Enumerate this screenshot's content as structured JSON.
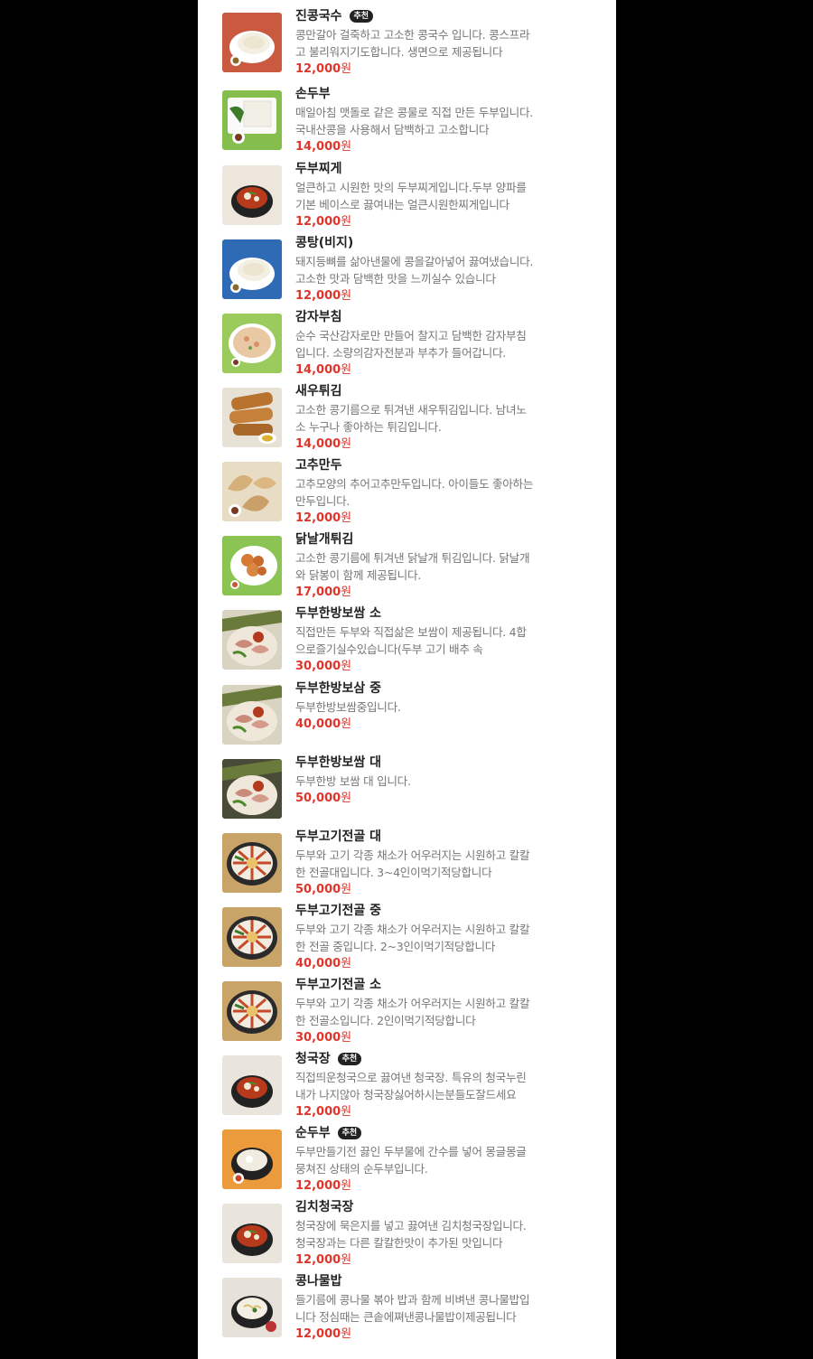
{
  "currency": "원",
  "badge_label": "추천",
  "items": [
    {
      "name": "진콩국수",
      "badge": true,
      "desc": [
        "콩만갈아 걸죽하고 고소한 콩국수 입니다. 콩스프라",
        "고 불리워지기도합니다. 생면으로 제공됩니다"
      ],
      "price": "12,000",
      "thumb": {
        "bg": "#c9593f",
        "dish": "bowl-white"
      }
    },
    {
      "name": "손두부",
      "badge": false,
      "desc": [
        "매일아침 맷돌로 같은 콩물로 직접 만든 두부입니다.",
        "국내산콩을 사용해서 담백하고 고소합니다"
      ],
      "price": "14,000",
      "thumb": {
        "bg": "#86be4e",
        "dish": "tofu"
      }
    },
    {
      "name": "두부찌게",
      "badge": false,
      "desc": [
        "얼큰하고 시원한 맛의 두부찌게입니다.두부 양파를",
        "기본 베이스로 끓여내는 얼큰시원한찌게입니다"
      ],
      "price": "12,000",
      "thumb": {
        "bg": "#ede6dc",
        "dish": "pot-red"
      }
    },
    {
      "name": "콩탕(비지)",
      "badge": false,
      "desc": [
        "돼지등뼈를 삶아낸물에 콩을갈아넣어 끓여냈습니다.",
        "고소한 맛과 담백한 맛을 느끼실수 있습니다"
      ],
      "price": "12,000",
      "thumb": {
        "bg": "#2f6bb5",
        "dish": "bowl-white"
      }
    },
    {
      "name": "감자부침",
      "badge": false,
      "desc": [
        "순수 국산감자로만 만들어 찰지고 담백한 감자부침",
        "입니다. 소량의감자전분과 부추가 들어갑니다."
      ],
      "price": "14,000",
      "thumb": {
        "bg": "#9acb5c",
        "dish": "pancake"
      }
    },
    {
      "name": "새우튀김",
      "badge": false,
      "desc": [
        "고소한 콩기름으로 튀겨낸 새우튀김입니다. 남녀노",
        "소 누구나 좋아하는 튀김입니다."
      ],
      "price": "14,000",
      "thumb": {
        "bg": "#e8e2d6",
        "dish": "fried"
      }
    },
    {
      "name": "고추만두",
      "badge": false,
      "desc": [
        "고추모양의 추어고추만두입니다. 아이들도 좋아하는",
        "만두입니다."
      ],
      "price": "12,000",
      "thumb": {
        "bg": "#e9dcc4",
        "dish": "dumpling"
      }
    },
    {
      "name": "닭날개튀김",
      "badge": false,
      "desc": [
        "고소한 콩기름에 튀겨낸 닭날개 튀김입니다. 닭날개",
        "와 닭봉이 함께 제공됩니다."
      ],
      "price": "17,000",
      "thumb": {
        "bg": "#8cc454",
        "dish": "wings"
      }
    },
    {
      "name": "두부한방보쌈 소",
      "badge": false,
      "desc": [
        "직접만든 두부와 직접삶은 보쌈이 제공됩니다. 4합",
        "으로즐기실수있습니다(두부 고기 배추 속"
      ],
      "price": "30,000",
      "thumb": {
        "bg": "#d9d3c2",
        "dish": "platter"
      }
    },
    {
      "name": "두부한방보삼 중",
      "badge": false,
      "desc": [
        "두부한방보쌈중입니다."
      ],
      "price": "40,000",
      "thumb": {
        "bg": "#d9d3c2",
        "dish": "platter"
      }
    },
    {
      "name": "두부한방보쌈 대",
      "badge": false,
      "desc": [
        "두부한방 보쌈 대 입니다."
      ],
      "price": "50,000",
      "thumb": {
        "bg": "#4a4a38",
        "dish": "platter"
      }
    },
    {
      "name": "두부고기전골 대",
      "badge": false,
      "desc": [
        "두부와 고기 각종 채소가 어우러지는 시원하고 칼칼",
        "한 전골대입니다. 3~4인이먹기적당합니다"
      ],
      "price": "50,000",
      "thumb": {
        "bg": "#c8a468",
        "dish": "hotpot"
      }
    },
    {
      "name": "두부고기전골 중",
      "badge": false,
      "desc": [
        "두부와 고기 각종 채소가 어우러지는 시원하고 칼칼",
        "한 전골 중입니다. 2~3인이먹기적당합니다"
      ],
      "price": "40,000",
      "thumb": {
        "bg": "#c8a468",
        "dish": "hotpot"
      }
    },
    {
      "name": "두부고기전골 소",
      "badge": false,
      "desc": [
        "두부와 고기 각종 채소가 어우러지는 시원하고 칼칼",
        "한 전골소입니다. 2인이먹기적당합니다"
      ],
      "price": "30,000",
      "thumb": {
        "bg": "#c8a468",
        "dish": "hotpot"
      }
    },
    {
      "name": "청국장",
      "badge": true,
      "desc": [
        "직접띄운청국으로 끓여낸 청국장. 특유의 청국누린",
        "내가 나지않아 청국장싫어하시는분들도잘드세요"
      ],
      "price": "12,000",
      "thumb": {
        "bg": "#e9e4dc",
        "dish": "pot-red"
      }
    },
    {
      "name": "순두부",
      "badge": true,
      "desc": [
        "두부만들기전 끓인 두부물에 간수를 넣어 몽글몽글",
        "뭉쳐진 상태의 순두부입니다."
      ],
      "price": "12,000",
      "thumb": {
        "bg": "#eb9b3c",
        "dish": "pot-white"
      }
    },
    {
      "name": "김치청국장",
      "badge": false,
      "desc": [
        "청국장에 묵은지를 넣고 끓여낸 김치청국장입니다.",
        "청국장과는 다른 칼칼한맛이 추가된 맛입니다"
      ],
      "price": "12,000",
      "thumb": {
        "bg": "#e9e4dc",
        "dish": "pot-red"
      }
    },
    {
      "name": "콩나물밥",
      "badge": false,
      "desc": [
        "들기름에 콩나물 볶아 밥과 함께 비벼낸 콩나물밥입",
        "니다 정심때는 큰솥에쪄낸콩나물밥이제공됩니다"
      ],
      "price": "12,000",
      "thumb": {
        "bg": "#e6e2da",
        "dish": "pot-rice"
      }
    }
  ]
}
